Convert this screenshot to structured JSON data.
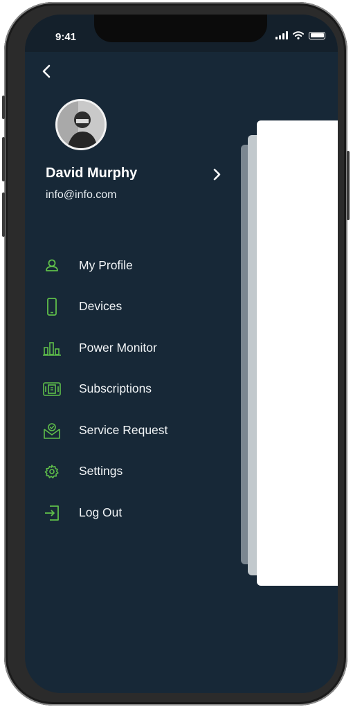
{
  "status_bar": {
    "time": "9:41"
  },
  "profile": {
    "name": "David Murphy",
    "email": "info@info.com"
  },
  "menu": [
    {
      "label": "My Profile",
      "icon": "user-icon"
    },
    {
      "label": "Devices",
      "icon": "phone-icon"
    },
    {
      "label": "Power Monitor",
      "icon": "bar-chart-icon"
    },
    {
      "label": "Subscriptions",
      "icon": "subscription-icon"
    },
    {
      "label": "Service Request",
      "icon": "service-request-icon"
    },
    {
      "label": "Settings",
      "icon": "gear-icon"
    },
    {
      "label": "Log Out",
      "icon": "logout-icon"
    }
  ],
  "colors": {
    "background": "#172837",
    "accent": "#5fbf4a",
    "text": "#ffffff"
  }
}
